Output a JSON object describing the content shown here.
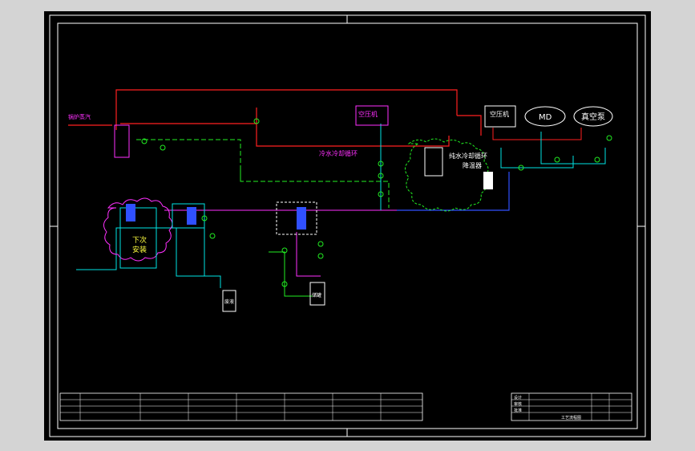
{
  "labels": {
    "steam_in": "锅炉蒸汽",
    "chilled_water": "冷水冷却循环",
    "chilled_water_2": "纯水冷却循环",
    "air_compressor": "空压机",
    "air_compressor_2": "空压机",
    "md": "MD",
    "vacuum_pump": "真空泵",
    "next_install_1": "下次",
    "next_install_2": "安装",
    "cooler_1": "纯水冷却循环",
    "cooler_2": "降温器",
    "tank_label": "储罐",
    "bucket_label": "废液"
  },
  "title_block": {
    "drawing_title": "工艺流程图",
    "rows": [
      "设计",
      "审核",
      "批准"
    ]
  },
  "colors": {
    "background": "#000000",
    "frame": "#ffffff",
    "red": "#ff2020",
    "green": "#22ee22",
    "cyan": "#00e5e5",
    "blue": "#3050ff",
    "magenta": "#ff30ff",
    "yellow": "#ffff40"
  }
}
